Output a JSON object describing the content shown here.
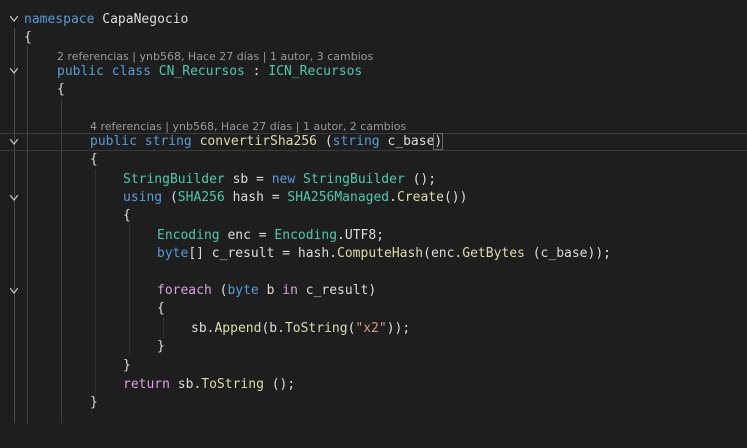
{
  "editor": {
    "line_namespace": {
      "kw": "namespace",
      "name": " CapaNegocio"
    },
    "brace": "{",
    "close_brace": "}",
    "lens_class": "2 referencias | ynb568, Hace 27 días | 1 autor, 3 cambios",
    "line_class": {
      "kw1": "public",
      "kw2": " class",
      "name": " CN_Recursos",
      "colon": " : ",
      "iface": "ICN_Recursos"
    },
    "lens_method": "4 referencias | ynb568, Hace 27 días | 1 autor, 2 cambios",
    "line_method": {
      "kw1": "public",
      "kw2": " string",
      "name": " convertirSha256",
      "open": " (",
      "ptype": "string",
      "pname": " c_base",
      "close": ")"
    },
    "line_sb": {
      "type": "StringBuilder",
      "rest1": " sb = ",
      "kw": "new",
      "sp": " ",
      "type2": "StringBuilder",
      "rest2": " ();"
    },
    "line_using": {
      "kw": "using",
      "open": " (",
      "type": "SHA256",
      "mid": " hash = ",
      "type2": "SHA256Managed",
      "dot": ".",
      "meth": "Create",
      "end": "())"
    },
    "line_enc": {
      "type": "Encoding",
      "mid": " enc = ",
      "type2": "Encoding",
      "end": ".UTF8;"
    },
    "line_result": {
      "kw": "byte",
      "mid": "[] c_result = hash.",
      "meth": "ComputeHash",
      "mid2": "(enc.",
      "meth2": "GetBytes",
      "end": " (c_base));"
    },
    "line_foreach": {
      "kw": "foreach",
      "open": " (",
      "kw2": "byte",
      "mid": " b ",
      "kw3": "in",
      "end": " c_result)"
    },
    "line_append": {
      "pre": "sb.",
      "meth": "Append",
      "mid": "(b.",
      "meth2": "ToString",
      "open": "(",
      "str": "\"x2\"",
      "end": "));"
    },
    "line_return": {
      "kw": "return",
      "mid": " sb.",
      "meth": "ToString",
      "end": " ();"
    }
  },
  "colors": {
    "background": "#1e1e1e",
    "keyword": "#569cd6",
    "control": "#d8a0df",
    "type": "#4ec9b0",
    "method": "#dcdcaa",
    "string": "#d69d85"
  },
  "icons": [
    "chevron-down-icon"
  ]
}
